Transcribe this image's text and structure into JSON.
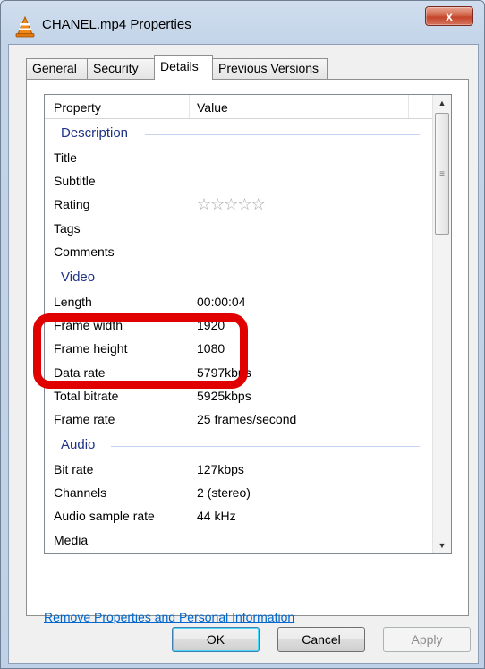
{
  "window": {
    "title": "CHANEL.mp4 Properties",
    "close_label": "x"
  },
  "tabs": [
    "General",
    "Security",
    "Details",
    "Previous Versions"
  ],
  "active_tab": "Details",
  "list": {
    "header": {
      "property": "Property",
      "value": "Value"
    },
    "groups": [
      {
        "label": "Description",
        "rows": [
          {
            "name": "Title",
            "value": ""
          },
          {
            "name": "Subtitle",
            "value": ""
          },
          {
            "name": "Rating",
            "value": "",
            "stars": 0,
            "max_stars": 5
          },
          {
            "name": "Tags",
            "value": ""
          },
          {
            "name": "Comments",
            "value": ""
          }
        ]
      },
      {
        "label": "Video",
        "rows": [
          {
            "name": "Length",
            "value": "00:00:04"
          },
          {
            "name": "Frame width",
            "value": "1920"
          },
          {
            "name": "Frame height",
            "value": "1080"
          },
          {
            "name": "Data rate",
            "value": "5797kbps"
          },
          {
            "name": "Total bitrate",
            "value": "5925kbps"
          },
          {
            "name": "Frame rate",
            "value": "25 frames/second"
          }
        ]
      },
      {
        "label": "Audio",
        "rows": [
          {
            "name": "Bit rate",
            "value": "127kbps"
          },
          {
            "name": "Channels",
            "value": "2 (stereo)"
          },
          {
            "name": "Audio sample rate",
            "value": "44 kHz"
          },
          {
            "name": "Media",
            "value": ""
          }
        ]
      }
    ]
  },
  "remove_link": "Remove Properties and Personal Information",
  "buttons": {
    "ok": "OK",
    "cancel": "Cancel",
    "apply": "Apply"
  },
  "colors": {
    "group_label": "#1e3287",
    "link": "#0066cc",
    "highlight": "#e00000"
  }
}
